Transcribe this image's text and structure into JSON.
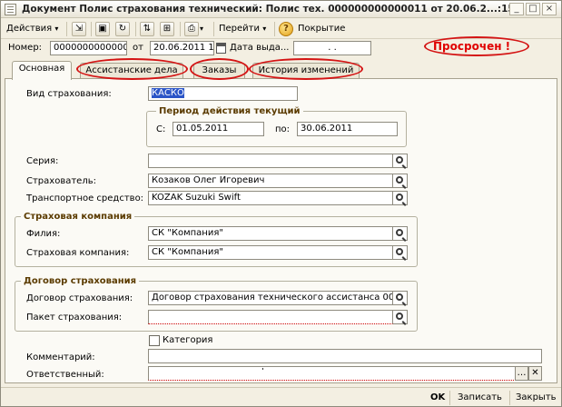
{
  "window": {
    "title": "Документ Полис страхования технический: Полис тех. 000000000000011 от 20.06.2...:15"
  },
  "toolbar": {
    "actions_label": "Действия",
    "goto_label": "Перейти",
    "coverage_label": "Покрытие"
  },
  "header": {
    "number_label": "Номер:",
    "number_value": "000000000000011",
    "from_label": "от",
    "date_value": "20.06.2011 1",
    "issue_date_label": "Дата выда...",
    "issue_date_value": ". .",
    "status": "Просрочен !"
  },
  "tabs": [
    {
      "label": "Основная"
    },
    {
      "label": "Ассистанские дела"
    },
    {
      "label": "Заказы"
    },
    {
      "label": "История изменений"
    }
  ],
  "form": {
    "insurance_type_label": "Вид страхования:",
    "insurance_type_value": "КАСКО",
    "period_title": "Период действия текущий",
    "period_from_label": "С:",
    "period_from_value": "01.05.2011",
    "period_to_label": "по:",
    "period_to_value": "30.06.2011",
    "series_label": "Серия:",
    "series_value": "",
    "insurer_label": "Страхователь:",
    "insurer_value": "Козаков Олег Игоревич",
    "vehicle_label": "Транспортное средство:",
    "vehicle_value": "KOZAK Suzuki Swift",
    "company_group_title": "Страховая компания",
    "branch_label": "Филия:",
    "branch_value": "СК \"Компания\"",
    "company_label": "Страховая компания:",
    "company_value": "СК \"Компания\"",
    "contract_group_title": "Договор страхования",
    "contract_label": "Договор страхования:",
    "contract_value": "Договор страхования технического ассистанса 000(",
    "package_label": "Пакет страхования:",
    "package_value": "",
    "category_label": "Категория",
    "comment_label": "Комментарий:",
    "comment_value": "",
    "responsible_label": "Ответственный:",
    "responsible_value": ""
  },
  "footer": {
    "ok_label": "OK",
    "save_label": "Записать",
    "close_label": "Закрыть"
  }
}
